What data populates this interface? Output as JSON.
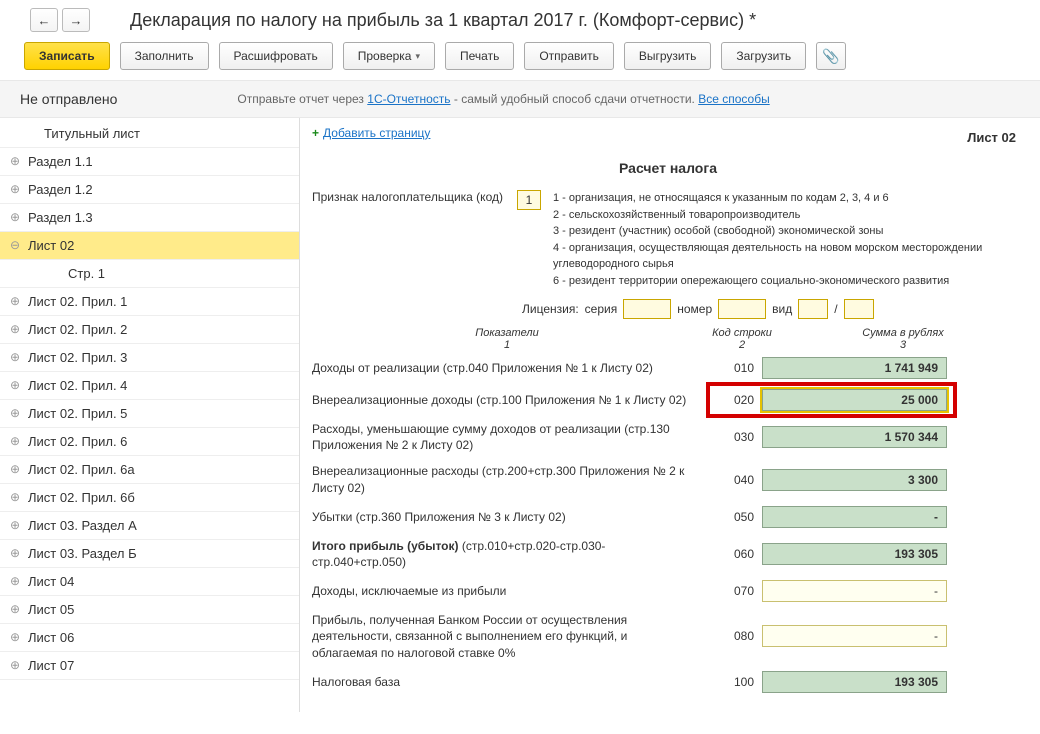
{
  "nav": {
    "back": "←",
    "fwd": "→"
  },
  "title": "Декларация по налогу на прибыль за 1 квартал 2017 г. (Комфорт-сервис) *",
  "toolbar": {
    "write": "Записать",
    "fill": "Заполнить",
    "decode": "Расшифровать",
    "check": "Проверка",
    "print": "Печать",
    "send": "Отправить",
    "unload": "Выгрузить",
    "load": "Загрузить"
  },
  "status": {
    "label": "Не отправлено",
    "hint_pre": "Отправьте отчет через ",
    "hint_link1": "1С-Отчетность",
    "hint_mid": " - самый удобный способ сдачи отчетности. ",
    "hint_link2": "Все способы"
  },
  "sidebar": {
    "items": [
      {
        "label": "Титульный лист",
        "exp": "",
        "indent": 1
      },
      {
        "label": "Раздел 1.1",
        "exp": "⊕",
        "indent": 0
      },
      {
        "label": "Раздел 1.2",
        "exp": "⊕",
        "indent": 0
      },
      {
        "label": "Раздел 1.3",
        "exp": "⊕",
        "indent": 0
      },
      {
        "label": "Лист 02",
        "exp": "⊖",
        "indent": 0,
        "selected": true
      },
      {
        "label": "Стр. 1",
        "exp": "",
        "indent": 2
      },
      {
        "label": "Лист 02. Прил. 1",
        "exp": "⊕",
        "indent": 0
      },
      {
        "label": "Лист 02. Прил. 2",
        "exp": "⊕",
        "indent": 0
      },
      {
        "label": "Лист 02. Прил. 3",
        "exp": "⊕",
        "indent": 0
      },
      {
        "label": "Лист 02. Прил. 4",
        "exp": "⊕",
        "indent": 0
      },
      {
        "label": "Лист 02. Прил. 5",
        "exp": "⊕",
        "indent": 0
      },
      {
        "label": "Лист 02. Прил. 6",
        "exp": "⊕",
        "indent": 0
      },
      {
        "label": "Лист 02. Прил. 6а",
        "exp": "⊕",
        "indent": 0
      },
      {
        "label": "Лист 02. Прил. 6б",
        "exp": "⊕",
        "indent": 0
      },
      {
        "label": "Лист 03. Раздел А",
        "exp": "⊕",
        "indent": 0
      },
      {
        "label": "Лист 03. Раздел Б",
        "exp": "⊕",
        "indent": 0
      },
      {
        "label": "Лист 04",
        "exp": "⊕",
        "indent": 0
      },
      {
        "label": "Лист 05",
        "exp": "⊕",
        "indent": 0
      },
      {
        "label": "Лист 06",
        "exp": "⊕",
        "indent": 0
      },
      {
        "label": "Лист 07",
        "exp": "⊕",
        "indent": 0
      }
    ]
  },
  "main": {
    "add_page": "Добавить страницу",
    "sheet_num": "Лист 02",
    "heading": "Расчет налога",
    "taxpayer_label": "Признак налогоплательщика (код)",
    "taxpayer_code": "1",
    "hints": [
      "1 - организация, не относящаяся к указанным по кодам 2, 3, 4 и 6",
      "2 - сельскохозяйственный товаропроизводитель",
      "3 - резидент (участник) особой (свободной) экономической зоны",
      "4 - организация, осуществляющая деятельность на новом морском месторождении углеводородного сырья",
      "6 - резидент территории опережающего социально-экономического развития"
    ],
    "license": {
      "label": "Лицензия:",
      "series": "серия",
      "number": "номер",
      "kind": "вид",
      "sep": "/"
    },
    "col_headers": {
      "c1": "Показатели",
      "c1n": "1",
      "c2": "Код строки",
      "c2n": "2",
      "c3": "Сумма в рублях",
      "c3n": "3"
    },
    "rows": [
      {
        "desc": "Доходы от реализации (стр.040 Приложения № 1 к Листу 02)",
        "code": "010",
        "value": "1 741 949",
        "green": true
      },
      {
        "desc": "Внереализационные доходы (стр.100 Приложения № 1 к Листу 02)",
        "code": "020",
        "value": "25 000",
        "green": true,
        "hl": true
      },
      {
        "desc": "Расходы, уменьшающие сумму доходов от реализации (стр.130 Приложения № 2 к Листу 02)",
        "code": "030",
        "value": "1 570 344",
        "green": true
      },
      {
        "desc": "Внереализационные расходы (стр.200+стр.300 Приложения № 2 к Листу 02)",
        "code": "040",
        "value": "3 300",
        "green": true
      },
      {
        "desc": "Убытки (стр.360 Приложения № 3 к Листу 02)",
        "code": "050",
        "value": "-",
        "green": true
      },
      {
        "desc": "<b>Итого прибыль (убыток)</b>   (стр.010+стр.020-стр.030-стр.040+стр.050)",
        "code": "060",
        "value": "193 305",
        "green": true,
        "bold": true
      },
      {
        "desc": "Доходы, исключаемые из прибыли",
        "code": "070",
        "value": "-",
        "green": false
      },
      {
        "desc": "Прибыль, полученная Банком России от осуществления деятельности, связанной с выполнением его функций, и облагаемая по налоговой ставке 0%",
        "code": "080",
        "value": "-",
        "green": false
      },
      {
        "desc": "Налоговая база",
        "code": "100",
        "value": "193 305",
        "green": true,
        "bold": true
      }
    ]
  }
}
